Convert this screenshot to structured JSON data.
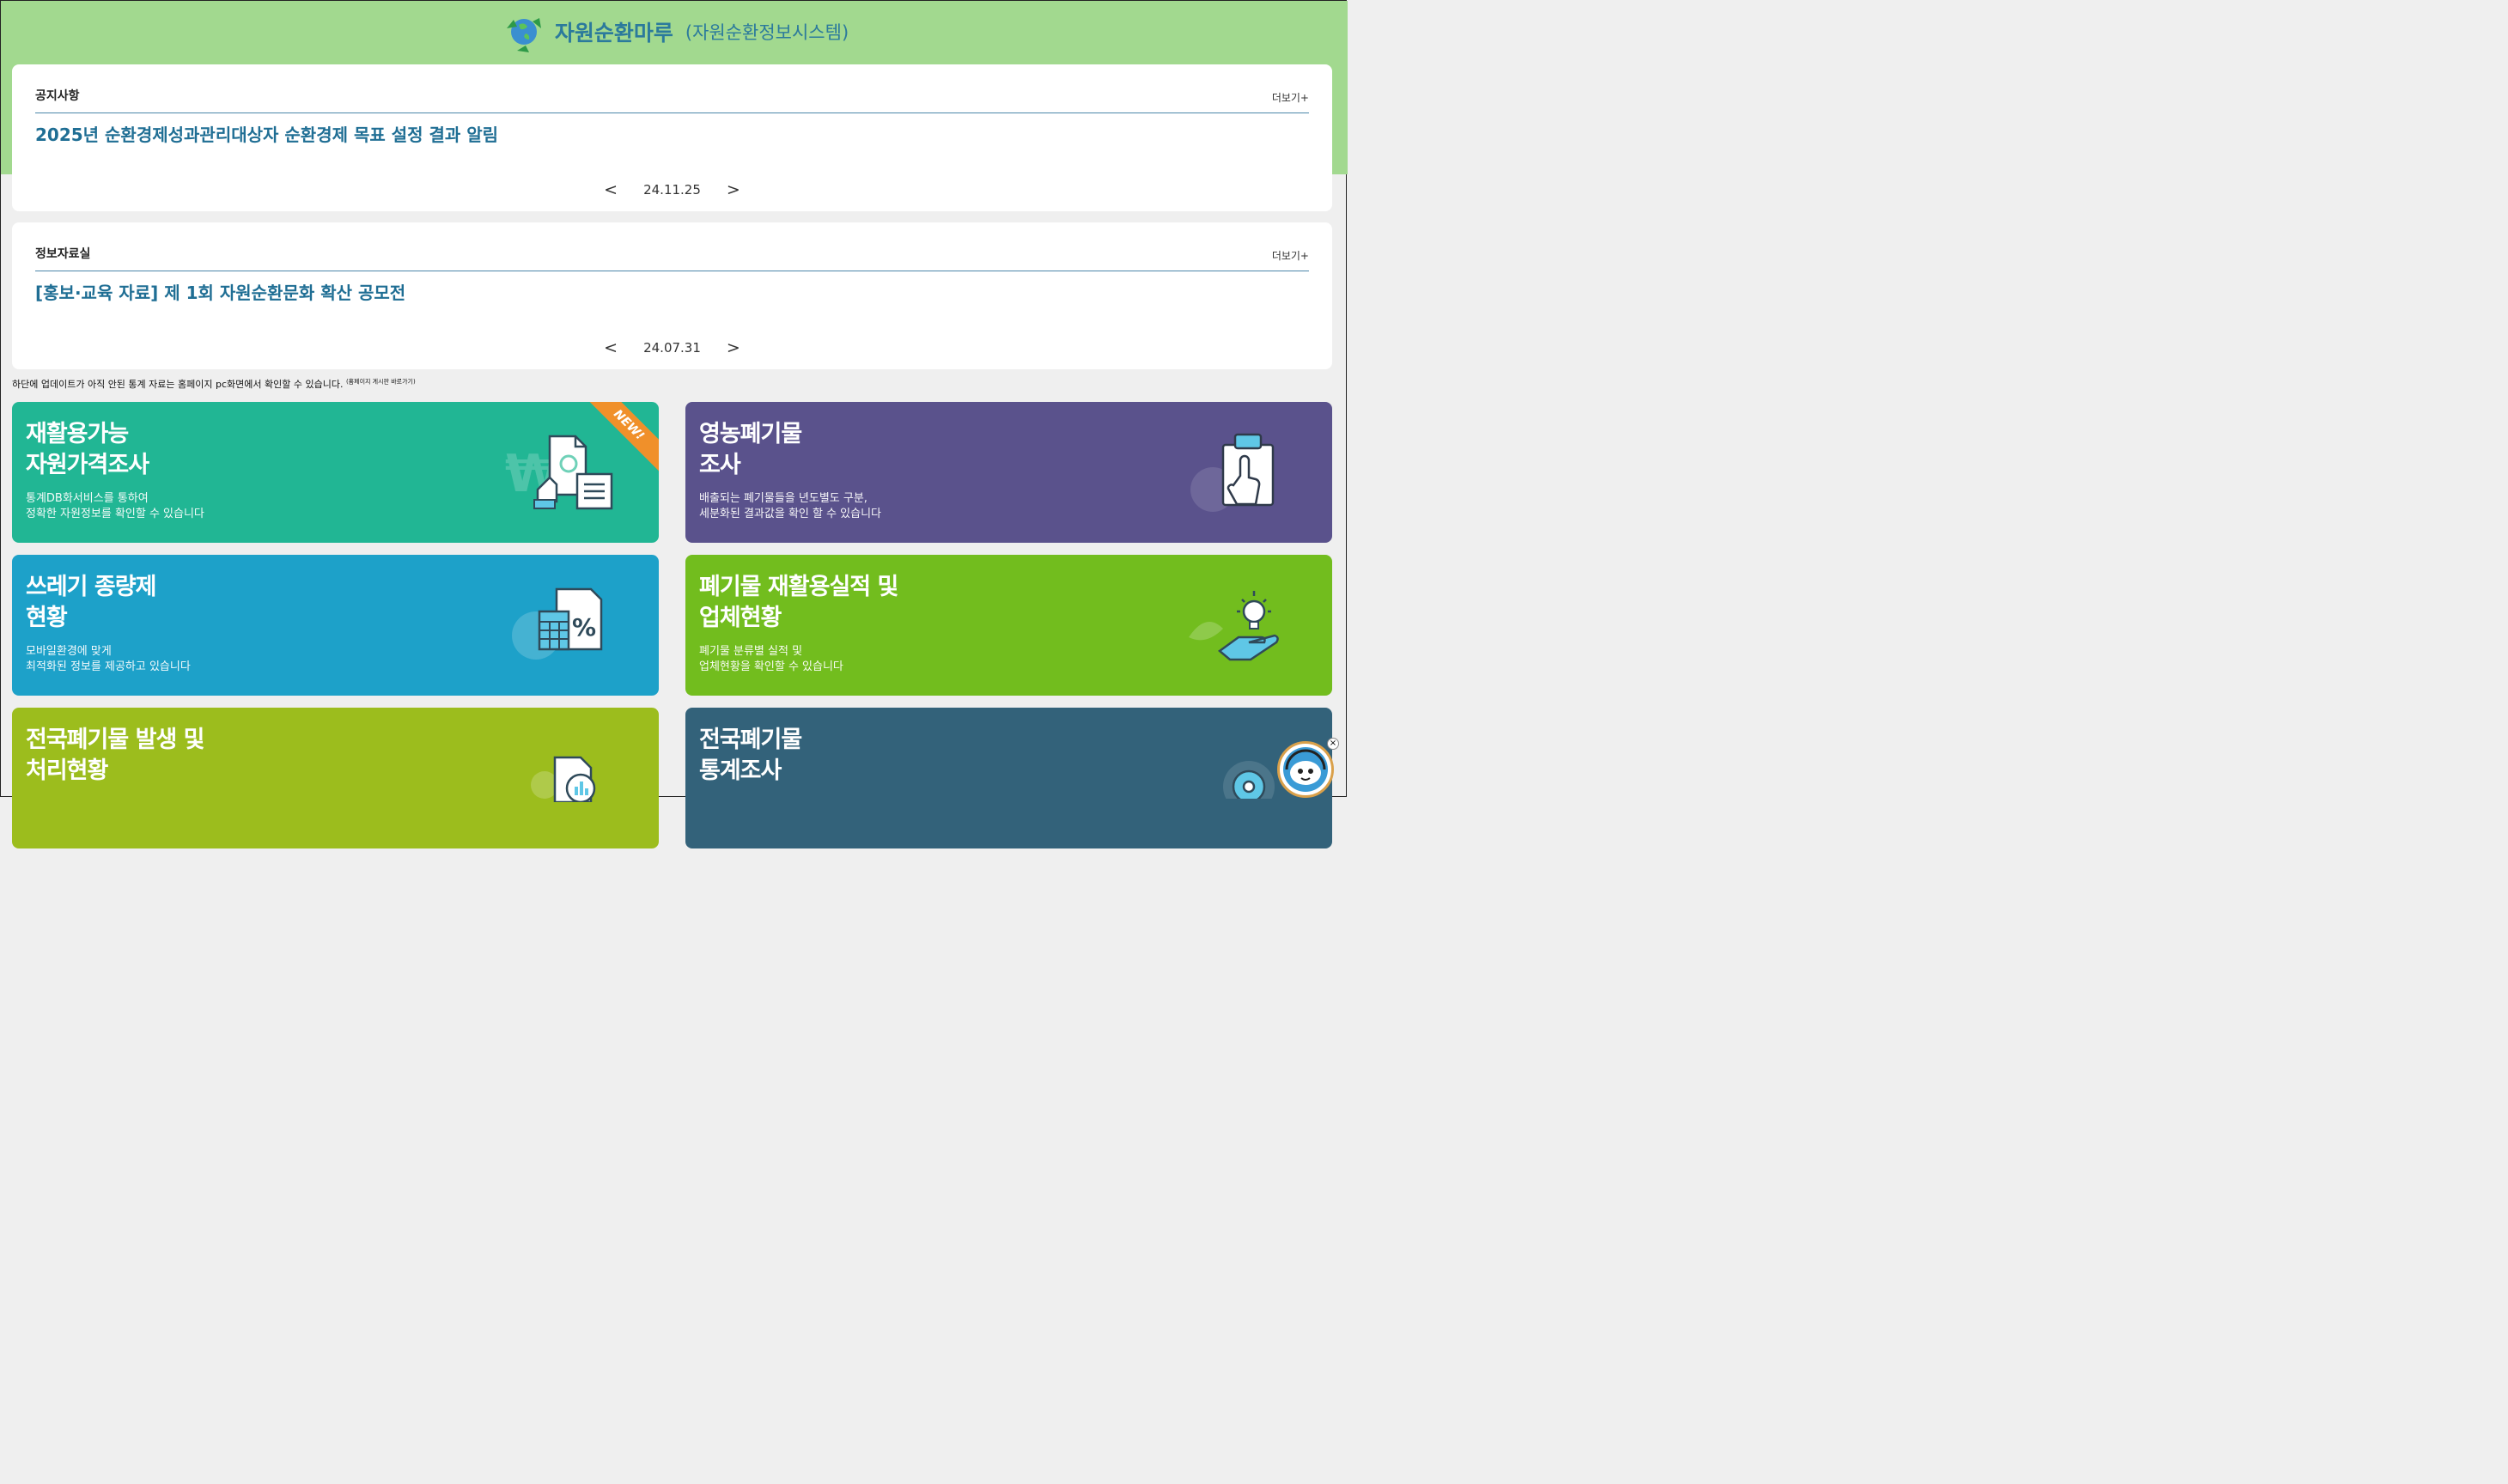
{
  "header": {
    "title": "자원순환마루",
    "subtitle": "(자원순환정보시스템)"
  },
  "notice_panel": {
    "title": "공지사항",
    "more_label": "더보기+",
    "headline": "2025년 순환경제성과관리대상자 순환경제 목표 설정 결과 알림",
    "date": "24.11.25",
    "prev_label": "<",
    "next_label": ">"
  },
  "info_panel": {
    "title": "정보자료실",
    "more_label": "더보기+",
    "headline": "[홍보·교육 자료] 제 1회 자원순환문화 확산 공모전",
    "date": "24.07.31",
    "prev_label": "<",
    "next_label": ">"
  },
  "update_notice": {
    "text": "하단에 업데이트가 아직 안된 통계 자료는 홈페이지 pc화면에서 확인할 수 있습니다.",
    "small": "(홈페이지 게시판 바로가기)"
  },
  "cards": [
    {
      "title_line1": "재활용가능",
      "title_line2": "자원가격조사",
      "desc_line1": "통계DB화서비스를 통하여",
      "desc_line2": "정확한 자원정보를 확인할 수 있습니다",
      "badge": "NEW!",
      "color": "#21b694",
      "icon": "document-price-icon"
    },
    {
      "title_line1": "영농폐기물",
      "title_line2": "조사",
      "desc_line1": "배출되는 폐기물들을 년도별도 구분,",
      "desc_line2": "세분화된 결과값을 확인 할 수 있습니다",
      "color": "#5a528c",
      "icon": "clipboard-touch-icon"
    },
    {
      "title_line1": "쓰레기 종량제",
      "title_line2": "현황",
      "desc_line1": "모바일환경에 맞게",
      "desc_line2": "최적화된 정보를 제공하고 있습니다",
      "color": "#1da1c9",
      "icon": "calculator-percent-icon"
    },
    {
      "title_line1": "폐기물 재활용실적 및",
      "title_line2": "업체현황",
      "desc_line1": "폐기물 분류별 실적 및",
      "desc_line2": "업체현황을 확인할 수 있습니다",
      "color": "#72bd1e",
      "icon": "hand-bulb-icon"
    },
    {
      "title_line1": "전국폐기물 발생 및",
      "title_line2": "처리현황",
      "color": "#9cbd1d",
      "icon": "chart-document-icon"
    },
    {
      "title_line1": "전국폐기물",
      "title_line2": "통계조사",
      "color": "#33627a",
      "icon": "disc-icon"
    }
  ],
  "chatbot": {
    "close_label": "×",
    "icon": "chatbot-avatar-icon"
  }
}
